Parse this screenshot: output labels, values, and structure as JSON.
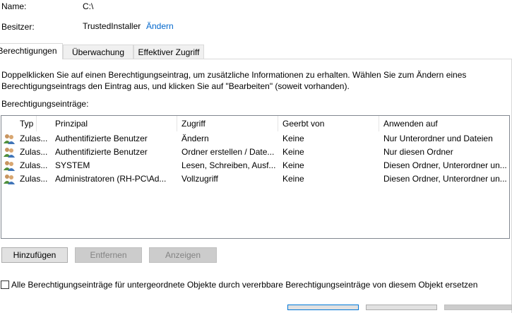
{
  "header": {
    "name_label": "Name:",
    "name_value": "C:\\",
    "owner_label": "Besitzer:",
    "owner_value": "TrustedInstaller",
    "owner_change_link": "Ändern"
  },
  "tabs": [
    {
      "label": "Berechtigungen",
      "active": true
    },
    {
      "label": "Überwachung",
      "active": false
    },
    {
      "label": "Effektiver Zugriff",
      "active": false
    }
  ],
  "instructions": {
    "line1": "Doppelklicken Sie auf einen Berechtigungseintrag, um zusätzliche Informationen zu erhalten. Wählen Sie zum Ändern eines",
    "line2": "Berechtigungseintrags den Eintrag aus, und klicken Sie auf \"Bearbeiten\" (soweit vorhanden)."
  },
  "entries_label": "Berechtigungseinträge:",
  "table": {
    "columns": [
      "Typ",
      "Prinzipal",
      "Zugriff",
      "Geerbt von",
      "Anwenden auf"
    ],
    "rows": [
      {
        "icon": "users-icon",
        "typ": "Zulas...",
        "prinzipal": "Authentifizierte Benutzer",
        "zugriff": "Ändern",
        "geerbt": "Keine",
        "anwenden": "Nur Unterordner und Dateien"
      },
      {
        "icon": "users-icon",
        "typ": "Zulas...",
        "prinzipal": "Authentifizierte Benutzer",
        "zugriff": "Ordner erstellen / Date...",
        "geerbt": "Keine",
        "anwenden": "Nur diesen Ordner"
      },
      {
        "icon": "users-icon",
        "typ": "Zulas...",
        "prinzipal": "SYSTEM",
        "zugriff": "Lesen, Schreiben, Ausf...",
        "geerbt": "Keine",
        "anwenden": "Diesen Ordner, Unterordner un..."
      },
      {
        "icon": "users-icon",
        "typ": "Zulas...",
        "prinzipal": "Administratoren (RH-PC\\Ad...",
        "zugriff": "Vollzugriff",
        "geerbt": "Keine",
        "anwenden": "Diesen Ordner, Unterordner un..."
      }
    ]
  },
  "buttons": {
    "add": "Hinzufügen",
    "remove": "Entfernen",
    "view": "Anzeigen"
  },
  "replace_checkbox_label": "Alle Berechtigungseinträge für untergeordnete Objekte durch vererbbare Berechtigungseinträge von diesem Objekt ersetzen",
  "colors": {
    "link": "#0066cc",
    "disabled_text": "#838383",
    "border": "#828790"
  }
}
